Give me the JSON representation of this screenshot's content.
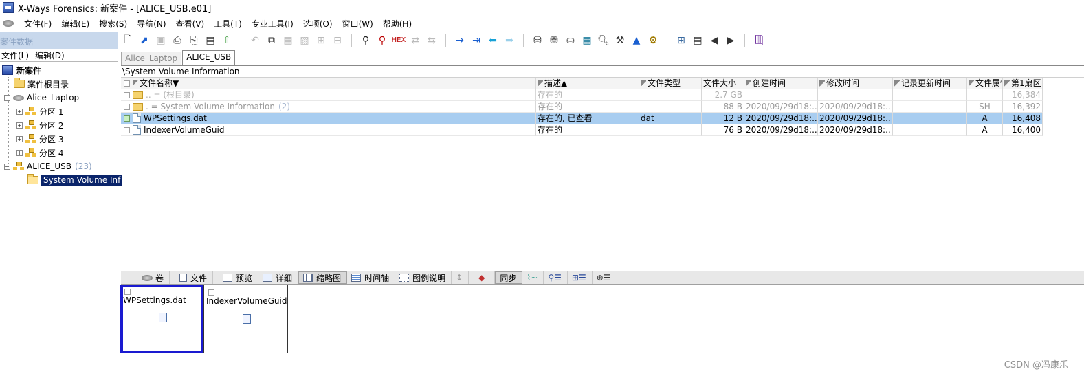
{
  "window": {
    "title": "X-Ways Forensics: 新案件 - [ALICE_USB.e01]"
  },
  "menu": [
    "文件(F)",
    "编辑(E)",
    "搜索(S)",
    "导航(N)",
    "查看(V)",
    "工具(T)",
    "专业工具(I)",
    "选项(O)",
    "窗口(W)",
    "帮助(H)"
  ],
  "left_panel": {
    "header": "案件数据",
    "menu": [
      "文件(L)",
      "编辑(D)"
    ],
    "tree": {
      "root": "新案件",
      "root_dir": "案件根目录",
      "laptop": "Alice_Laptop",
      "partitions": [
        "分区 1",
        "分区 2",
        "分区 3",
        "分区 4"
      ],
      "usb": "ALICE_USB",
      "usb_count": "(23)",
      "selected": "System Volume Inf"
    }
  },
  "toolbar_icons": [
    "new-file-icon",
    "open-icon",
    "save-icon",
    "print-icon",
    "print-preview-icon",
    "properties-icon",
    "export-icon",
    "undo-icon",
    "copy-icon",
    "paste-icon",
    "paste-special-icon",
    "hex-icon",
    "search-icon",
    "search-text-icon",
    "search-hex-icon",
    "replace-icon",
    "replace-hex-icon",
    "goto-icon",
    "goto-offset-icon",
    "back-icon",
    "forward-icon",
    "disk-icon",
    "add-disk-icon",
    "ram-icon",
    "calculator-icon",
    "zoom-icon",
    "tools-icon",
    "image-icon",
    "settings-icon",
    "grid-icon",
    "list-icon",
    "play-back-icon",
    "play-forward-icon",
    "book-icon"
  ],
  "case_tabs": [
    "Alice_Laptop",
    "ALICE_USB"
  ],
  "path": "\\System Volume Information",
  "table": {
    "columns": [
      "文件名称▼",
      "描述▲",
      "文件类型",
      "文件大小",
      "创建时间",
      "修改时间",
      "记录更新时间",
      "文件属性",
      "第1扇区"
    ],
    "rows": [
      {
        "name": "..   =   (根目录)",
        "desc": "存在的",
        "type": "",
        "size": "2.7 GB",
        "created": "",
        "modified": "",
        "record": "",
        "attr": "",
        "sector": "16,384"
      },
      {
        "name": ".    =   System Volume Information",
        "count": "(2)",
        "desc": "存在的",
        "type": "",
        "size": "88 B",
        "created": "2020/09/29d18:...",
        "modified": "2020/09/29d18:...",
        "record": "",
        "attr": "SH",
        "sector": "16,392"
      },
      {
        "name": "WPSettings.dat",
        "desc": "存在的, 已查看",
        "type": "dat",
        "size": "12 B",
        "created": "2020/09/29d18:...",
        "modified": "2020/09/29d18:...",
        "record": "",
        "attr": "A",
        "sector": "16,408"
      },
      {
        "name": "IndexerVolumeGuid",
        "desc": "存在的",
        "type": "",
        "size": "76 B",
        "created": "2020/09/29d18:...",
        "modified": "2020/09/29d18:...",
        "record": "",
        "attr": "A",
        "sector": "16,400"
      }
    ]
  },
  "bottom_tabs": [
    "卷",
    "文件",
    "预览",
    "详细",
    "缩略图",
    "时间轴",
    "图例说明",
    "↕",
    "◆",
    "同步"
  ],
  "thumbnails": [
    "WPSettings.dat",
    "IndexerVolumeGuid"
  ],
  "watermark": "CSDN @冯康乐"
}
